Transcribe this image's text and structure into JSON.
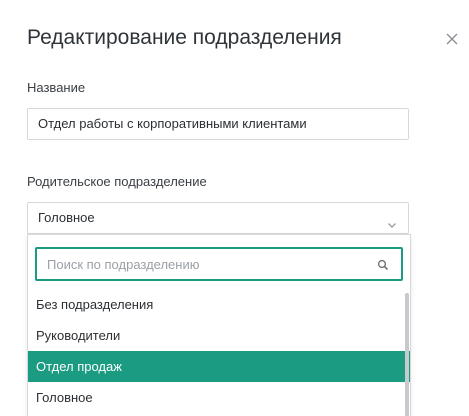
{
  "dialog": {
    "title": "Редактирование подразделения",
    "close_icon": "close-icon"
  },
  "name_field": {
    "label": "Название",
    "value": "Отдел работы с корпоративными клиентами"
  },
  "parent_field": {
    "label": "Родительское подразделение",
    "selected": "Головное",
    "chevron_icon": "chevron-down-icon"
  },
  "dropdown": {
    "search_placeholder": "Поиск по подразделению",
    "search_icon": "search-icon",
    "options": [
      {
        "label": "Без подразделения",
        "highlighted": false
      },
      {
        "label": "Руководители",
        "highlighted": false
      },
      {
        "label": "Отдел продаж",
        "highlighted": true
      },
      {
        "label": "Головное",
        "highlighted": false
      }
    ]
  },
  "colors": {
    "accent": "#1a9b82",
    "border": "#d6d9dc",
    "text": "#2b2f33"
  }
}
